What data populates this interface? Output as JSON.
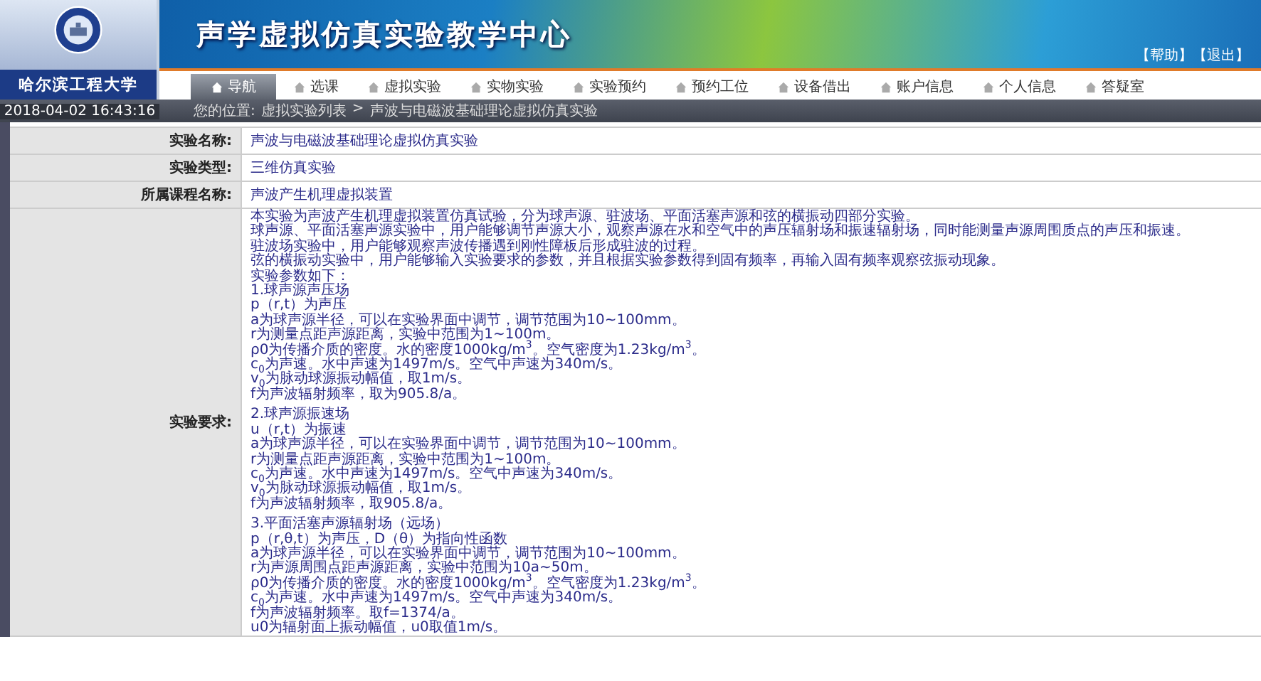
{
  "header": {
    "school": "哈尔滨工程大学",
    "title": "声学虚拟仿真实验教学中心",
    "links": [
      "【帮助】",
      "【退出】"
    ]
  },
  "nav": [
    {
      "label": "导航",
      "selected": true
    },
    {
      "label": "选课",
      "selected": false
    },
    {
      "label": "虚拟实验",
      "selected": false
    },
    {
      "label": "实物实验",
      "selected": false
    },
    {
      "label": "实验预约",
      "selected": false
    },
    {
      "label": "预约工位",
      "selected": false
    },
    {
      "label": "设备借出",
      "selected": false
    },
    {
      "label": "账户信息",
      "selected": false
    },
    {
      "label": "个人信息",
      "selected": false
    },
    {
      "label": "答疑室",
      "selected": false
    }
  ],
  "datetime": "2018-04-02   16:43:16",
  "breadcrumb": {
    "prefix": "您的位置:",
    "items": [
      "虚拟实验列表",
      "声波与电磁波基础理论虚拟仿真实验"
    ],
    "separator": ">"
  },
  "fields": [
    {
      "label": "实验名称:",
      "value": "声波与电磁波基础理论虚拟仿真实验"
    },
    {
      "label": "实验类型:",
      "value": "三维仿真实验"
    },
    {
      "label": "所属课程名称:",
      "value": "声波产生机理虚拟装置"
    }
  ],
  "requirement": {
    "label": "实验要求:",
    "paragraphs": [
      [
        "本实验为声波产生机理虚拟装置仿真试验，分为球声源、驻波场、平面活塞声源和弦的横振动四部分实验。",
        "球声源、平面活塞声源实验中，用户能够调节声源大小，观察声源在水和空气中的声压辐射场和振速辐射场，同时能测量声源周围质点的声压和振速。",
        "驻波场实验中，用户能够观察声波传播遇到刚性障板后形成驻波的过程。",
        "弦的横振动实验中，用户能够输入实验要求的参数，并且根据实验参数得到固有频率，再输入固有频率观察弦振动现象。",
        "实验参数如下：",
        "1.球声源声压场",
        "p（r,t）为声压",
        "a为球声源半径，可以在实验界面中调节，调节范围为10~100mm。",
        "r为测量点距声源距离，实验中范围为1~100m。",
        "ρ0为传播介质的密度。水的密度1000kg/m$^{3}$。空气密度为1.23kg/m$^{3}$。",
        "c$_{0}$为声速。水中声速为1497m/s。空气中声速为340m/s。",
        "v$_{0}$为脉动球源振动幅值，取1m/s。",
        "f为声波辐射频率，取为905.8/a。"
      ],
      [
        "2.球声源振速场",
        "u（r,t）为振速",
        "a为球声源半径，可以在实验界面中调节，调节范围为10~100mm。",
        "r为测量点距声源距离，实验中范围为1~100m。",
        "c$_{0}$为声速。水中声速为1497m/s。空气中声速为340m/s。",
        "v$_{0}$为脉动球源振动幅值，取1m/s。",
        "f为声波辐射频率，取905.8/a。"
      ],
      [
        "3.平面活塞声源辐射场（远场）",
        "p（r,θ,t）为声压，D（θ）为指向性函数",
        "a为球声源半径，可以在实验界面中调节，调节范围为10~100mm。",
        "r为声源周围点距声源距离，实验中范围为10a~50m。",
        "ρ0为传播介质的密度。水的密度1000kg/m$^{3}$。空气密度为1.23kg/m$^{3}$。",
        "c$_{0}$为声速。水中声速为1497m/s。空气中声速为340m/s。",
        "f为声波辐射频率。取f=1374/a。",
        "u0为辐射面上振动幅值，u0取值1m/s。"
      ]
    ]
  }
}
